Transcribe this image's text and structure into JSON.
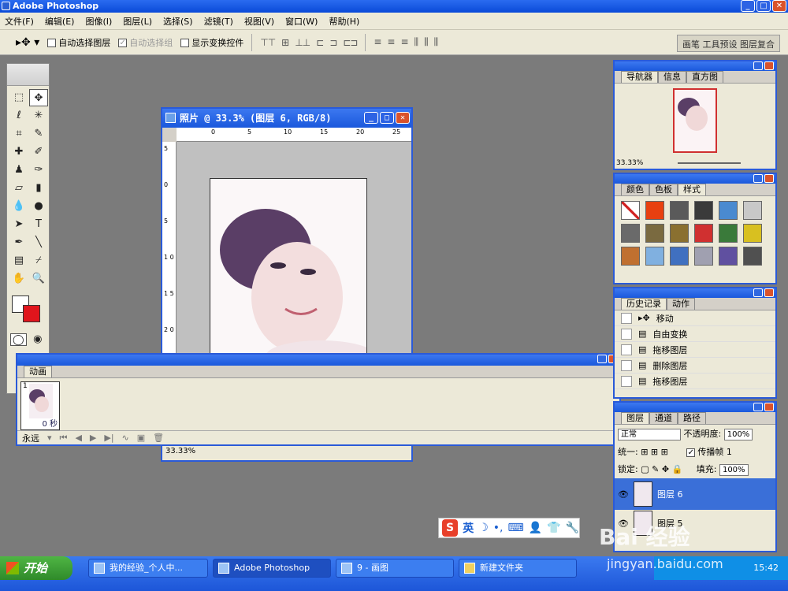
{
  "app": {
    "title": "Adobe Photoshop"
  },
  "menubar": {
    "items": [
      "文件(F)",
      "编辑(E)",
      "图像(I)",
      "图层(L)",
      "选择(S)",
      "滤镜(T)",
      "视图(V)",
      "窗口(W)",
      "帮助(H)"
    ]
  },
  "options": {
    "auto_select_layer": "自动选择图层",
    "auto_select_group": "自动选择组",
    "show_transform": "显示变换控件",
    "well_label": "画笔 工具预设 图层复合"
  },
  "document": {
    "title": "照片 @ 33.3% (图层 6, RGB/8)",
    "zoom": "33.33%",
    "ruler_top": [
      "0",
      "5",
      "10",
      "15",
      "20",
      "25"
    ],
    "ruler_left": [
      "5",
      "0",
      "5",
      "1 0",
      "1 5",
      "2 0"
    ]
  },
  "animation": {
    "tab": "动画",
    "frame_number": "1",
    "frame_delay": "0 秒",
    "loop": "永远"
  },
  "navigator": {
    "tabs": [
      "导航器",
      "信息",
      "直方图"
    ],
    "zoom": "33.33%"
  },
  "styles": {
    "tabs": [
      "颜色",
      "色板",
      "样式"
    ],
    "swatch_colors": [
      "#ffffff",
      "#e84010",
      "#5a5a5a",
      "#3a3a3a",
      "#4a8ad0",
      "#c8c8c8",
      "#6a6a6a",
      "#7a6a40",
      "#8a7030",
      "#d03030",
      "#3a7a3a",
      "#d8c020",
      "#c07030",
      "#80b0e0",
      "#4070c0",
      "#a0a0b0",
      "#6050a0",
      "#505050"
    ]
  },
  "history": {
    "tabs": [
      "历史记录",
      "动作"
    ],
    "items": [
      "移动",
      "自由变换",
      "拖移图层",
      "删除图层",
      "拖移图层"
    ]
  },
  "layers": {
    "tabs": [
      "图层",
      "通道",
      "路径"
    ],
    "blend_mode": "正常",
    "opacity_label": "不透明度:",
    "opacity": "100%",
    "unify_label": "统一:",
    "propagate_label": "传播帧 1",
    "lock_label": "锁定:",
    "fill_label": "填充:",
    "fill": "100%",
    "layer_names": [
      "图层 6",
      "图层 5"
    ]
  },
  "ime": {
    "mode": "英"
  },
  "watermark": {
    "text": "Bai 经验",
    "url": "jingyan.baidu.com"
  },
  "taskbar": {
    "start": "开始",
    "tasks": [
      "我的经验_个人中...",
      "Adobe Photoshop",
      "9 - 画图",
      "新建文件夹"
    ],
    "time": "15:42"
  }
}
